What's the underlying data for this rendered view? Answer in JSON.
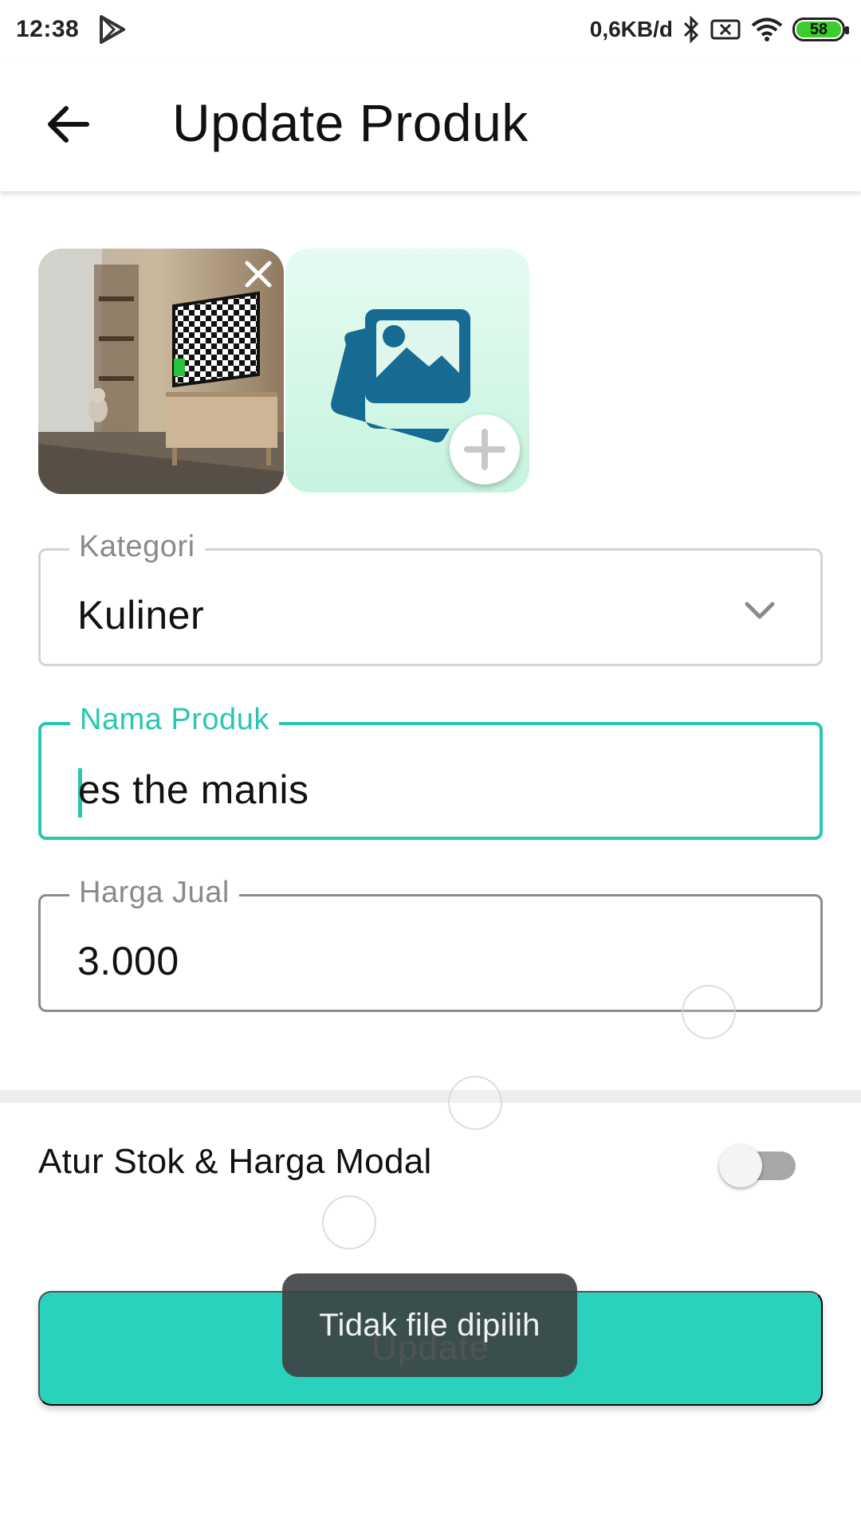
{
  "status_bar": {
    "time": "12:38",
    "net_speed": "0,6KB/d",
    "battery": "58",
    "icons": [
      "play-store-icon",
      "bluetooth-icon",
      "sim-x-icon",
      "wifi-icon",
      "battery-icon"
    ]
  },
  "app_bar": {
    "title": "Update Produk",
    "back_icon": "arrow-left-icon"
  },
  "images": {
    "photo_icon": "photo-thumbnail",
    "remove_icon": "close-icon",
    "add_icon": "add-image-icon"
  },
  "form": {
    "kategori": {
      "label": "Kategori",
      "value": "Kuliner"
    },
    "nama_produk": {
      "label": "Nama Produk",
      "value": "es the manis"
    },
    "harga_jual": {
      "label": "Harga Jual",
      "value": "3.000"
    }
  },
  "settings": {
    "stok_label": "Atur Stok & Harga Modal",
    "stok_enabled": false
  },
  "actions": {
    "update_label": "Update"
  },
  "toast": {
    "message": "Tidak file dipilih"
  },
  "colors": {
    "accent": "#2ac6b3",
    "button": "#2ad1bd",
    "icon_blue": "#176a91",
    "add_bg": "#d6f7e8"
  }
}
